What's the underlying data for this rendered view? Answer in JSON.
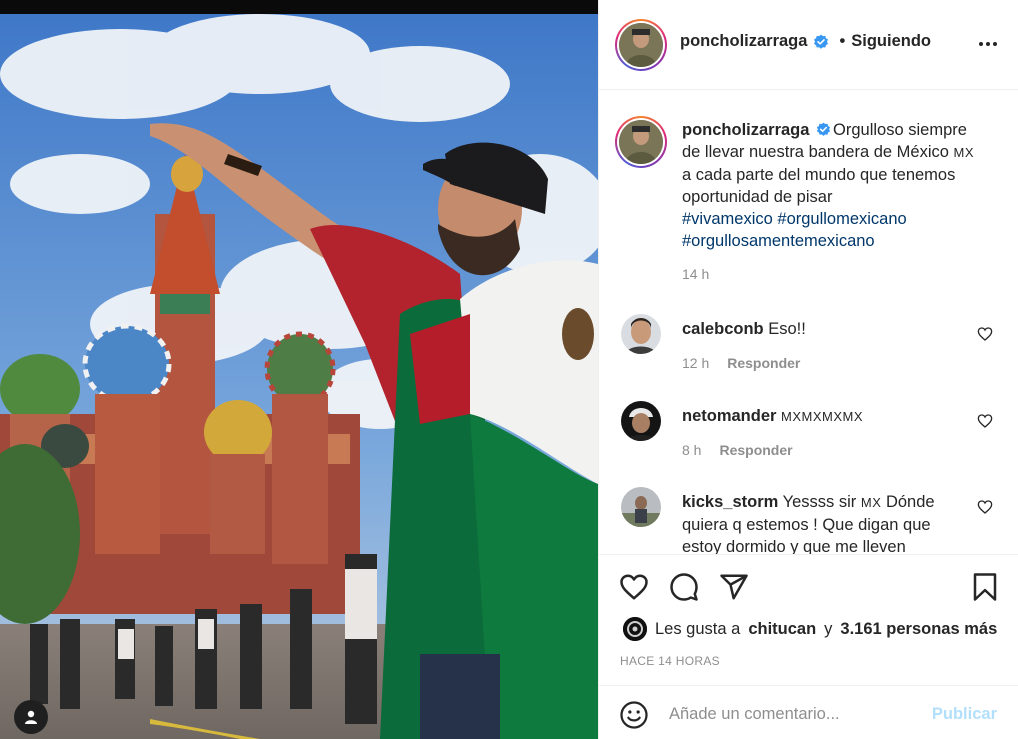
{
  "post": {
    "author": "poncholizarraga",
    "dot": "•",
    "following_label": "Siguiendo"
  },
  "caption": {
    "username": "poncholizarraga",
    "text": "Orgulloso siempre de llevar nuestra bandera de México ",
    "flag_text": "MX",
    "text2": " a cada parte del mundo que tenemos oportunidad de pisar ",
    "hashtags": [
      "#vivamexico",
      "#orgullomexicano",
      "#orgullosamentemexicano"
    ],
    "time": "14 h"
  },
  "comments": [
    {
      "username": "calebconb",
      "text": "Eso!!",
      "time": "12 h",
      "reply_label": "Responder"
    },
    {
      "username": "netomander",
      "text": "MXMXMXMX",
      "time": "8 h",
      "reply_label": "Responder"
    },
    {
      "username": "kicks_storm",
      "text_a": "Yessss sir ",
      "flag": "MX",
      "text_b": " Dónde quiera q estemos ! Que digan que estoy dormido y que me lleven"
    }
  ],
  "likes": {
    "prefix": "Les gusta a",
    "user": "chitucan",
    "joiner": "y",
    "count_text": "3.161 personas más"
  },
  "time_ago": "HACE 14 HORAS",
  "add_comment": {
    "placeholder": "Añade un comentario...",
    "publish_label": "Publicar"
  },
  "icons": {
    "options": "more-horizontal-icon",
    "like": "heart-icon",
    "comment": "comment-bubble-icon",
    "share": "paper-plane-icon",
    "save": "bookmark-icon",
    "emoji": "smiley-icon",
    "tags": "user-tag-icon",
    "verified": "verified-badge-icon"
  },
  "colors": {
    "verified": "#3897f0",
    "hashtag": "#00376b",
    "publish_disabled": "#b2dffc",
    "muted": "#8e8e8e"
  }
}
